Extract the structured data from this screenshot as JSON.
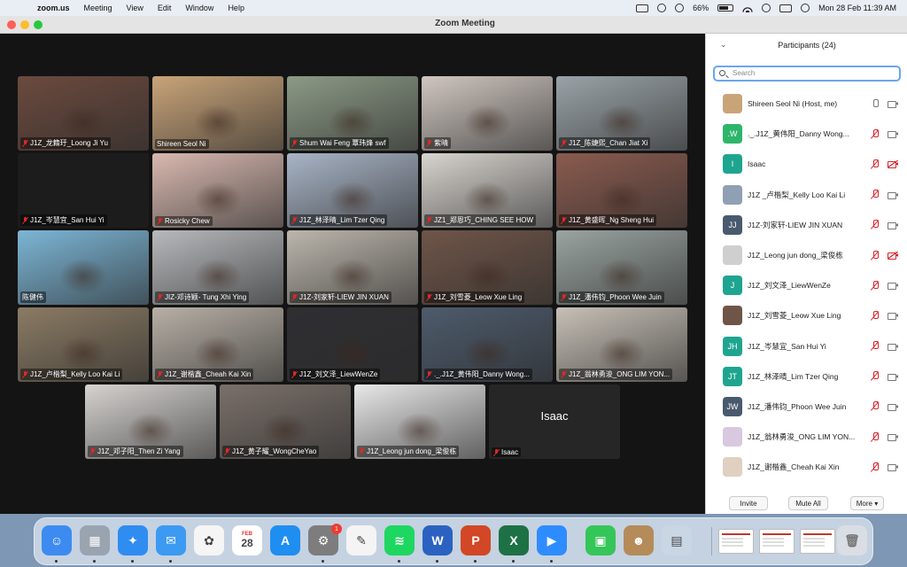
{
  "menubar": {
    "app_name": "zoom.us",
    "items": [
      "Meeting",
      "View",
      "Edit",
      "Window",
      "Help"
    ],
    "battery": "66%",
    "clock": "Mon 28 Feb  11:39 AM"
  },
  "window": {
    "title": "Zoom Meeting"
  },
  "gallery": {
    "tiles": [
      {
        "name": "J1Z_龙籍玗_Loong Ji Yu",
        "muted": true,
        "bg": "#6b4a3e"
      },
      {
        "name": "Shireen Seol Ni",
        "muted": false,
        "bg": "#c9a479"
      },
      {
        "name": "Shum Wai Feng 覃玮烽 swf",
        "muted": true,
        "bg": "#8c9a86"
      },
      {
        "name": "紫晴",
        "muted": true,
        "bg": "#cfc6c0"
      },
      {
        "name": "J1Z_陈婕熙_Chan Jiat Xi",
        "muted": true,
        "bg": "#9aa3a8"
      },
      {
        "name": "J1Z_岑慧宜_San Hui Yi",
        "muted": true,
        "bg": "#1c1c1c"
      },
      {
        "name": "Rosicky Chew",
        "muted": true,
        "bg": "#d9b9b0"
      },
      {
        "name": "J1Z_林泽晴_Lim Tzer Qing",
        "muted": true,
        "bg": "#a8b4c6"
      },
      {
        "name": "JZ1_郑恩巧_CHING SEE HOW",
        "muted": true,
        "bg": "#d8d4cf"
      },
      {
        "name": "J1Z_黄盛晖_Ng Sheng Hui",
        "muted": true,
        "bg": "#8a5b4f"
      },
      {
        "name": "陈健伟",
        "muted": false,
        "bg": "#7cb6d6"
      },
      {
        "name": "JIZ-邓诗颖- Tung Xhi Ying",
        "muted": true,
        "bg": "#b7b9bc"
      },
      {
        "name": "J1Z-刘家轩-LIEW JIN XUAN",
        "muted": true,
        "bg": "#bcb6ac"
      },
      {
        "name": "J1Z_刘雪菱_Leow Xue Ling",
        "muted": true,
        "bg": "#6f5548"
      },
      {
        "name": "J1Z_潘伟钧_Phoon Wee Juin",
        "muted": true,
        "bg": "#9aa4a0",
        "active": true
      },
      {
        "name": "J1Z_卢楷梨_Kelly Loo Kai Li",
        "muted": true,
        "bg": "#8b7b64"
      },
      {
        "name": "J1Z_谢楷鑫_Cheah Kai Xin",
        "muted": true,
        "bg": "#b8b0a6"
      },
      {
        "name": "J1Z_刘文泽_LiewWenZe",
        "muted": true,
        "bg": "#2f2f33"
      },
      {
        "name": "._.J1Z_黄伟阳_Danny Wong...",
        "muted": true,
        "bg": "#4d5b6c"
      },
      {
        "name": "J1Z_翁林勇浚_ONG LIM YON...",
        "muted": true,
        "bg": "#c7c0b6"
      },
      {
        "name": "J1Z_邓子阳_Then Zi Yang",
        "muted": true,
        "bg": "#d6d3d0"
      },
      {
        "name": "J1Z_黄子耀_WongCheYao",
        "muted": true,
        "bg": "#7a706a"
      },
      {
        "name": "J1Z_Leong jun dong_梁俊栋",
        "muted": true,
        "bg": "#e8e8e8"
      },
      {
        "name": "Isaac",
        "muted": true,
        "bg": "#262626",
        "name_only": "Isaac"
      }
    ]
  },
  "panel": {
    "title": "Participants (24)",
    "search_placeholder": "Search",
    "participants": [
      {
        "name": "Shireen Seol Ni (Host, me)",
        "initials": "",
        "color": "#c9a479",
        "mic_muted": false,
        "cam_off": false
      },
      {
        "name": "._.J1Z_黄伟阳_Danny Wong...",
        "initials": ".W",
        "color": "#2db56b",
        "mic_muted": true,
        "cam_off": false
      },
      {
        "name": "Isaac",
        "initials": "I",
        "color": "#1fa58f",
        "mic_muted": true,
        "cam_off": true
      },
      {
        "name": "J1Z _卢楷梨_Kelly Loo Kai Li",
        "initials": "",
        "color": "#8fa0b4",
        "mic_muted": true,
        "cam_off": false
      },
      {
        "name": "J1Z-刘家轩-LIEW JIN XUAN",
        "initials": "JJ",
        "color": "#4a5a6e",
        "mic_muted": true,
        "cam_off": false
      },
      {
        "name": "J1Z_Leong jun dong_梁俊栋",
        "initials": "",
        "color": "#cfcfcf",
        "mic_muted": true,
        "cam_off": true
      },
      {
        "name": "J1Z_刘文泽_LiewWenZe",
        "initials": "J",
        "color": "#1fa58f",
        "mic_muted": true,
        "cam_off": false
      },
      {
        "name": "J1Z_刘雪菱_Leow Xue Ling",
        "initials": "",
        "color": "#6f5548",
        "mic_muted": true,
        "cam_off": false
      },
      {
        "name": "J1Z_岑慧宜_San Hui Yi",
        "initials": "JH",
        "color": "#1fa58f",
        "mic_muted": true,
        "cam_off": false
      },
      {
        "name": "J1Z_林泽晴_Lim Tzer Qing",
        "initials": "JT",
        "color": "#1fa58f",
        "mic_muted": true,
        "cam_off": false
      },
      {
        "name": "J1Z_潘伟钧_Phoon Wee Juin",
        "initials": "JW",
        "color": "#4a5a6e",
        "mic_muted": true,
        "cam_off": false
      },
      {
        "name": "J1Z_翁林勇浚_ONG LIM YON...",
        "initials": "",
        "color": "#d8c8e0",
        "mic_muted": true,
        "cam_off": false
      },
      {
        "name": "J1Z_谢楷鑫_Cheah Kai Xin",
        "initials": "",
        "color": "#e0d0c0",
        "mic_muted": true,
        "cam_off": false
      }
    ],
    "buttons": {
      "invite": "Invite",
      "mute_all": "Mute All",
      "more": "More ▾"
    }
  },
  "dock": {
    "apps": [
      {
        "name": "finder-icon",
        "color": "#3d8bf0",
        "glyph": "☺"
      },
      {
        "name": "launchpad-icon",
        "color": "#9aa4b0",
        "glyph": "▦"
      },
      {
        "name": "safari-icon",
        "color": "#2f8cf0",
        "glyph": "✦"
      },
      {
        "name": "mail-icon",
        "color": "#3c9af2",
        "glyph": "✉"
      },
      {
        "name": "photos-icon",
        "color": "#f5f5f5",
        "glyph": "✿"
      },
      {
        "name": "calendar-icon",
        "color": "#ffffff",
        "glyph": "28"
      },
      {
        "name": "app-store-icon",
        "color": "#1f8ef1",
        "glyph": "A"
      },
      {
        "name": "system-preferences-icon",
        "color": "#7d7d7d",
        "glyph": "⚙"
      },
      {
        "name": "textedit-icon",
        "color": "#f4f4f4",
        "glyph": "✎"
      },
      {
        "name": "spotify-icon",
        "color": "#1ed760",
        "glyph": "≋"
      },
      {
        "name": "word-icon",
        "color": "#2b62c1",
        "glyph": "W"
      },
      {
        "name": "powerpoint-icon",
        "color": "#d24726",
        "glyph": "P"
      },
      {
        "name": "excel-icon",
        "color": "#1e7145",
        "glyph": "X"
      },
      {
        "name": "zoom-icon",
        "color": "#2d8cff",
        "glyph": "▶"
      },
      {
        "name": "facetime-icon",
        "color": "#35c659",
        "glyph": "▣"
      },
      {
        "name": "contacts-icon",
        "color": "#b58b5a",
        "glyph": "☻"
      },
      {
        "name": "preview-icon",
        "color": "#c9d6e4",
        "glyph": "▤"
      }
    ],
    "calendar_month": "FEB",
    "calendar_day": "28",
    "settings_badge": "1"
  }
}
